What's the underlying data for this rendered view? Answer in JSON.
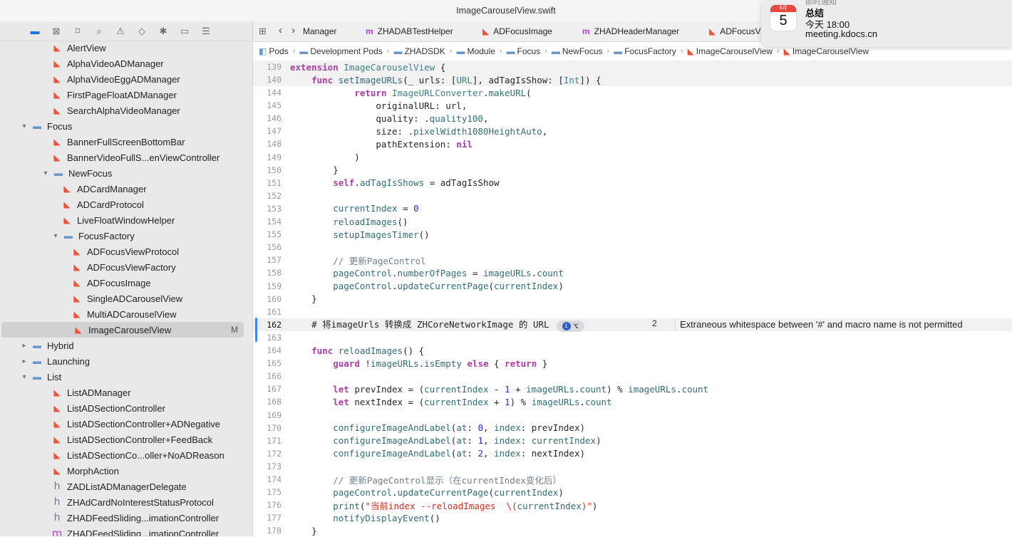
{
  "window": {
    "title": "ImageCarouselView.swift"
  },
  "navigator": {
    "toolbar_icons": [
      "folder-icon",
      "source-control-icon",
      "bookmark-icon",
      "find-icon",
      "issue-icon",
      "test-icon",
      "debug-icon",
      "breakpoint-icon",
      "report-icon"
    ],
    "items": [
      {
        "label": "AlertView",
        "icon": "swift",
        "indent": 2
      },
      {
        "label": "AlphaVideoADManager",
        "icon": "swift",
        "indent": 2
      },
      {
        "label": "AlphaVideoEggADManager",
        "icon": "swift",
        "indent": 2
      },
      {
        "label": "FirstPageFloatADManager",
        "icon": "swift",
        "indent": 2
      },
      {
        "label": "SearchAlphaVideoManager",
        "icon": "swift",
        "indent": 2
      },
      {
        "label": "Focus",
        "icon": "folder",
        "indent": 1,
        "disclosure": "open"
      },
      {
        "label": "BannerFullScreenBottomBar",
        "icon": "swift",
        "indent": 2
      },
      {
        "label": "BannerVideoFullS...enViewController",
        "icon": "swift",
        "indent": 2
      },
      {
        "label": "NewFocus",
        "icon": "folder",
        "indent": 2,
        "disclosure": "open"
      },
      {
        "label": "ADCardManager",
        "icon": "swift",
        "indent": 3
      },
      {
        "label": "ADCardProtocol",
        "icon": "swift",
        "indent": 3
      },
      {
        "label": "LiveFloatWindowHelper",
        "icon": "swift",
        "indent": 3
      },
      {
        "label": "FocusFactory",
        "icon": "folder",
        "indent": 3,
        "disclosure": "open"
      },
      {
        "label": "ADFocusViewProtocol",
        "icon": "swift",
        "indent": 4
      },
      {
        "label": "ADFocusViewFactory",
        "icon": "swift",
        "indent": 4
      },
      {
        "label": "ADFocusImage",
        "icon": "swift",
        "indent": 4
      },
      {
        "label": "SingleADCarouselView",
        "icon": "swift",
        "indent": 4
      },
      {
        "label": "MultiADCarouselView",
        "icon": "swift",
        "indent": 4
      },
      {
        "label": "ImageCarouselView",
        "icon": "swift",
        "indent": 4,
        "selected": true,
        "badge": "M"
      },
      {
        "label": "Hybrid",
        "icon": "folder",
        "indent": 1,
        "disclosure": "closed"
      },
      {
        "label": "Launching",
        "icon": "folder",
        "indent": 1,
        "disclosure": "closed"
      },
      {
        "label": "List",
        "icon": "folder",
        "indent": 1,
        "disclosure": "open"
      },
      {
        "label": "ListADManager",
        "icon": "swift",
        "indent": 2
      },
      {
        "label": "ListADSectionController",
        "icon": "swift",
        "indent": 2
      },
      {
        "label": "ListADSectionController+ADNegative",
        "icon": "swift",
        "indent": 2
      },
      {
        "label": "ListADSectionController+FeedBack",
        "icon": "swift",
        "indent": 2
      },
      {
        "label": "ListADSectionCo...oller+NoADReason",
        "icon": "swift",
        "indent": 2
      },
      {
        "label": "MorphAction",
        "icon": "swift",
        "indent": 2
      },
      {
        "label": "ZADListADManagerDelegate",
        "icon": "h",
        "indent": 2
      },
      {
        "label": "ZHAdCardNoInterestStatusProtocol",
        "icon": "h",
        "indent": 2
      },
      {
        "label": "ZHADFeedSliding...imationController",
        "icon": "h",
        "indent": 2
      },
      {
        "label": "ZHADFeedSliding...imationController",
        "icon": "m",
        "indent": 2
      }
    ]
  },
  "tabs": [
    {
      "label": "Manager",
      "icon": "none"
    },
    {
      "label": "ZHADABTestHelper",
      "icon": "m"
    },
    {
      "label": "ADFocusImage",
      "icon": "swift"
    },
    {
      "label": "ZHADHeaderManager",
      "icon": "m"
    },
    {
      "label": "ADFocusVi",
      "icon": "swift"
    }
  ],
  "breadcrumb": [
    "Pods",
    "Development Pods",
    "ZHADSDK",
    "Module",
    "Focus",
    "NewFocus",
    "FocusFactory",
    "ImageCarouselView",
    "ImageCarouselView"
  ],
  "code": {
    "sticky": [
      {
        "n": "139",
        "html": "<span class='kw'>extension</span> <span class='ty'>ImageCarouselView</span> {"
      },
      {
        "n": "140",
        "html": "    <span class='kw'>func</span> <span class='fn'>setImageURLs</span>(_ urls: [<span class='ty'>URL</span>], adTagIsShow: [<span class='ty'>Int</span>]) {"
      }
    ],
    "lines": [
      {
        "n": "144",
        "html": "            <span class='kw'>return</span> <span class='ty'>ImageURLConverter</span>.<span class='fn'>makeURL</span>("
      },
      {
        "n": "145",
        "html": "                originalURL: url,"
      },
      {
        "n": "146",
        "html": "                quality: .<span class='fn'>quality100</span>,"
      },
      {
        "n": "147",
        "html": "                size: .<span class='fn'>pixelWidth1080HeightAuto</span>,"
      },
      {
        "n": "148",
        "html": "                pathExtension: <span class='kw'>nil</span>"
      },
      {
        "n": "149",
        "html": "            )"
      },
      {
        "n": "150",
        "html": "        }"
      },
      {
        "n": "151",
        "html": "        <span class='kw'>self</span>.<span class='fn'>adTagIsShows</span> = adTagIsShow"
      },
      {
        "n": "152",
        "html": ""
      },
      {
        "n": "153",
        "html": "        <span class='fn'>currentIndex</span> = <span class='num'>0</span>"
      },
      {
        "n": "154",
        "html": "        <span class='fn'>reloadImages</span>()"
      },
      {
        "n": "155",
        "html": "        <span class='fn'>setupImagesTimer</span>()"
      },
      {
        "n": "156",
        "html": ""
      },
      {
        "n": "157",
        "html": "        <span class='cm'>// 更新PageControl</span>"
      },
      {
        "n": "158",
        "html": "        <span class='fn'>pageControl</span>.<span class='fn'>numberOfPages</span> = <span class='fn'>imageURLs</span>.<span class='fn'>count</span>"
      },
      {
        "n": "159",
        "html": "        <span class='fn'>pageControl</span>.<span class='fn'>updateCurrentPage</span>(<span class='fn'>currentIndex</span>)"
      },
      {
        "n": "160",
        "html": "    }"
      },
      {
        "n": "161",
        "html": ""
      },
      {
        "n": "162",
        "html": "    # 将imageUrls 转换成 ZHCoreNetworkImage 的 URL",
        "current": true
      },
      {
        "n": "163",
        "html": ""
      },
      {
        "n": "164",
        "html": "    <span class='kw'>func</span> <span class='fn'>reloadImages</span>() {"
      },
      {
        "n": "165",
        "html": "        <span class='kw'>guard</span> !<span class='fn'>imageURLs</span>.<span class='fn'>isEmpty</span> <span class='kw'>else</span> { <span class='kw'>return</span> }"
      },
      {
        "n": "166",
        "html": ""
      },
      {
        "n": "167",
        "html": "        <span class='kw'>let</span> prevIndex = (<span class='fn'>currentIndex</span> - <span class='num'>1</span> + <span class='fn'>imageURLs</span>.<span class='fn'>count</span>) % <span class='fn'>imageURLs</span>.<span class='fn'>count</span>"
      },
      {
        "n": "168",
        "html": "        <span class='kw'>let</span> nextIndex = (<span class='fn'>currentIndex</span> + <span class='num'>1</span>) % <span class='fn'>imageURLs</span>.<span class='fn'>count</span>"
      },
      {
        "n": "169",
        "html": ""
      },
      {
        "n": "170",
        "html": "        <span class='fn'>configureImageAndLabel</span>(<span class='fn'>at</span>: <span class='num'>0</span>, <span class='fn'>index</span>: prevIndex)"
      },
      {
        "n": "171",
        "html": "        <span class='fn'>configureImageAndLabel</span>(<span class='fn'>at</span>: <span class='num'>1</span>, <span class='fn'>index</span>: <span class='fn'>currentIndex</span>)"
      },
      {
        "n": "172",
        "html": "        <span class='fn'>configureImageAndLabel</span>(<span class='fn'>at</span>: <span class='num'>2</span>, <span class='fn'>index</span>: nextIndex)"
      },
      {
        "n": "173",
        "html": ""
      },
      {
        "n": "174",
        "html": "        <span class='cm'>// 更新PageControl显示（在currentIndex变化后）</span>"
      },
      {
        "n": "175",
        "html": "        <span class='fn'>pageControl</span>.<span class='fn'>updateCurrentPage</span>(<span class='fn'>currentIndex</span>)"
      },
      {
        "n": "176",
        "html": "        <span class='fn'>print</span>(<span class='str'>\"当前index --reloadImages  \\(</span><span class='fn'>currentIndex</span><span class='str'>)\"</span>)"
      },
      {
        "n": "177",
        "html": "        <span class='fn'>notifyDisplayEvent</span>()"
      },
      {
        "n": "178",
        "html": "    }"
      }
    ]
  },
  "issue": {
    "count": "2",
    "message": "Extraneous whitespace between '#' and macro name is not permitted",
    "fixit_glyph": "⌥"
  },
  "notification": {
    "app": "即时通知",
    "month": "6月",
    "day": "5",
    "title": "总结",
    "time": "今天 18:00",
    "body": "meeting.kdocs.cn"
  }
}
